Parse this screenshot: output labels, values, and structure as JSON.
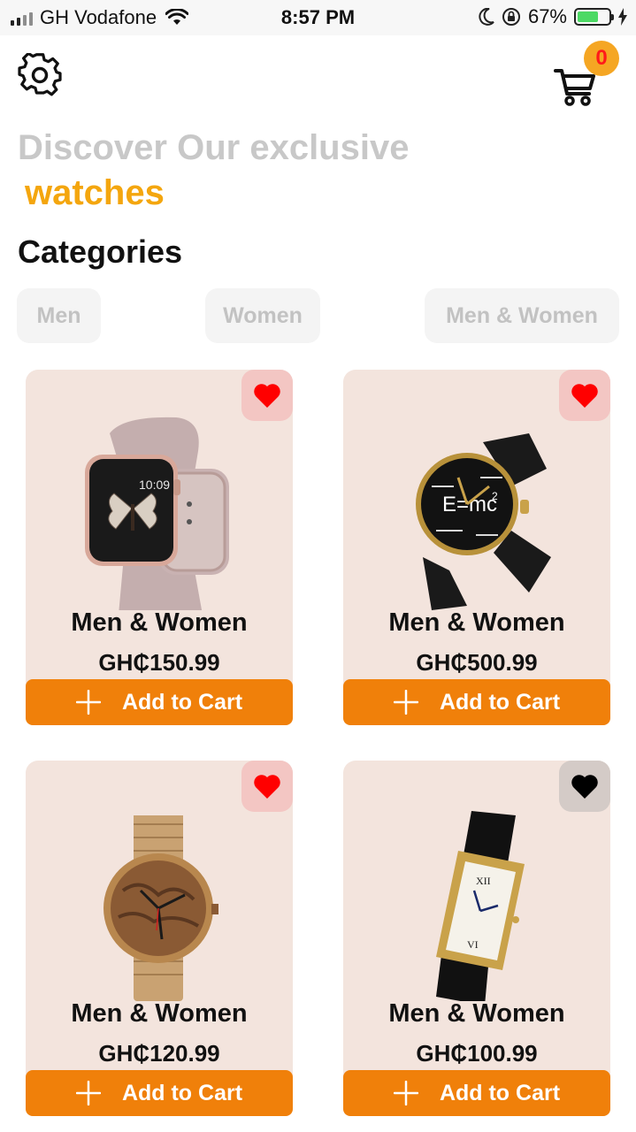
{
  "status_bar": {
    "carrier": "GH Vodafone",
    "time": "8:57 PM",
    "battery": "67%",
    "battery_level": 0.67
  },
  "header": {
    "cart_count": "0"
  },
  "headline": {
    "line1": "Discover Our exclusive",
    "line2": "watches"
  },
  "categories": {
    "title": "Categories",
    "items": [
      "Men",
      "Women",
      "Men & Women"
    ]
  },
  "products": [
    {
      "name": "Men & Women",
      "price": "GH₵150.99",
      "add_label": "Add to Cart",
      "favorite": true,
      "watch_time": "10:09"
    },
    {
      "name": "Men & Women",
      "price": "GH₵500.99",
      "add_label": "Add to Cart",
      "favorite": true
    },
    {
      "name": "Men & Women",
      "price": "GH₵120.99",
      "add_label": "Add to Cart",
      "favorite": true
    },
    {
      "name": "Men & Women",
      "price": "GH₵100.99",
      "add_label": "Add to Cart",
      "favorite": false
    }
  ],
  "colors": {
    "accent": "#f0800a",
    "headline_highlight": "#f4a60e",
    "favorite_on": "#ff0000",
    "favorite_off": "#000000",
    "card_bg": "#f3e4dd"
  }
}
